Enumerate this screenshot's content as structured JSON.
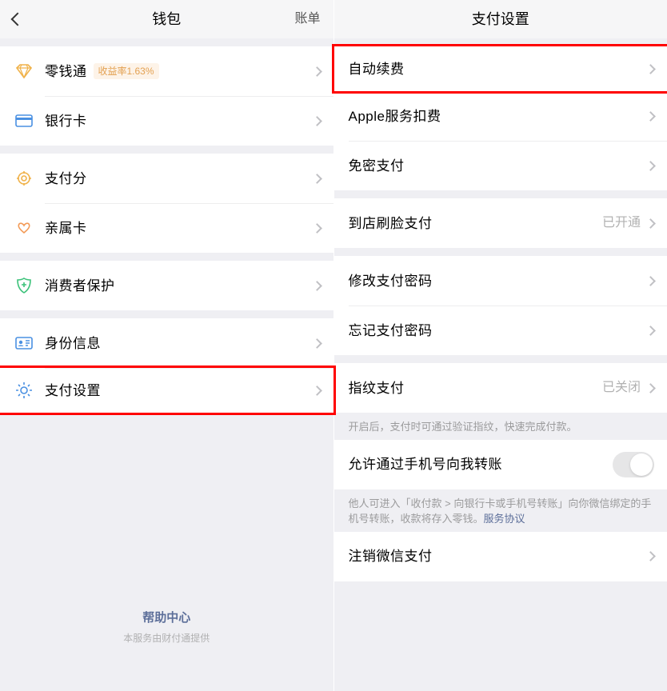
{
  "left": {
    "nav": {
      "title": "钱包",
      "right": "账单"
    },
    "groups": [
      [
        {
          "icon": "diamond-icon",
          "label": "零钱通",
          "tag": "收益率1.63%"
        },
        {
          "icon": "card-icon",
          "label": "银行卡"
        }
      ],
      [
        {
          "icon": "cog-circle-icon",
          "label": "支付分"
        },
        {
          "icon": "hearts-icon",
          "label": "亲属卡"
        }
      ],
      [
        {
          "icon": "shield-icon",
          "label": "消费者保护"
        }
      ],
      [
        {
          "icon": "id-icon",
          "label": "身份信息"
        },
        {
          "icon": "gear-icon",
          "label": "支付设置"
        }
      ]
    ],
    "footer": {
      "help": "帮助中心",
      "provider": "本服务由财付通提供"
    }
  },
  "right": {
    "nav": {
      "title": "支付设置"
    },
    "rows": {
      "auto_renew": "自动续费",
      "apple": "Apple服务扣费",
      "no_pass": "免密支付",
      "face": "到店刷脸支付",
      "face_val": "已开通",
      "change_pw": "修改支付密码",
      "forgot_pw": "忘记支付密码",
      "fingerprint": "指纹支付",
      "fingerprint_val": "已关闭",
      "fingerprint_note": "开启后，支付时可通过验证指纹，快速完成付款。",
      "phone_transfer": "允许通过手机号向我转账",
      "phone_note": "他人可进入「收付款 > 向银行卡或手机号转账」向你微信绑定的手机号转账，收款将存入零钱。",
      "phone_link": "服务协议",
      "deregister": "注销微信支付"
    }
  }
}
